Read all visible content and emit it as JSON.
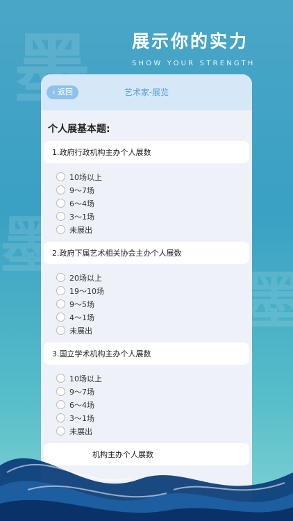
{
  "header": {
    "title": "展示你的实力",
    "subtitle": "SHOW YOUR STRENGTH"
  },
  "nav": {
    "back_label": "返回",
    "title": "艺术家-展览"
  },
  "section_title": "个人展基本题:",
  "questions": [
    {
      "label": "1.政府行政机构主办个人展数",
      "options": [
        "10场以上",
        "9～7场",
        "6～4场",
        "3～1场",
        "未展出"
      ]
    },
    {
      "label": "2.政府下属艺术相关协会主办个人展数",
      "options": [
        "20场以上",
        "19～10场",
        "9～5场",
        "4～1场",
        "未展出"
      ]
    },
    {
      "label": "3.国立学术机构主办个人展数",
      "options": [
        "10场以上",
        "9～7场",
        "6～4场",
        "3～1场",
        "未展出"
      ]
    },
    {
      "label": "机构主办个人展数",
      "options": []
    }
  ],
  "colors": {
    "accent": "#5a9fd4",
    "back_button": "#8fc2ea",
    "background": "#4aa6c7"
  }
}
